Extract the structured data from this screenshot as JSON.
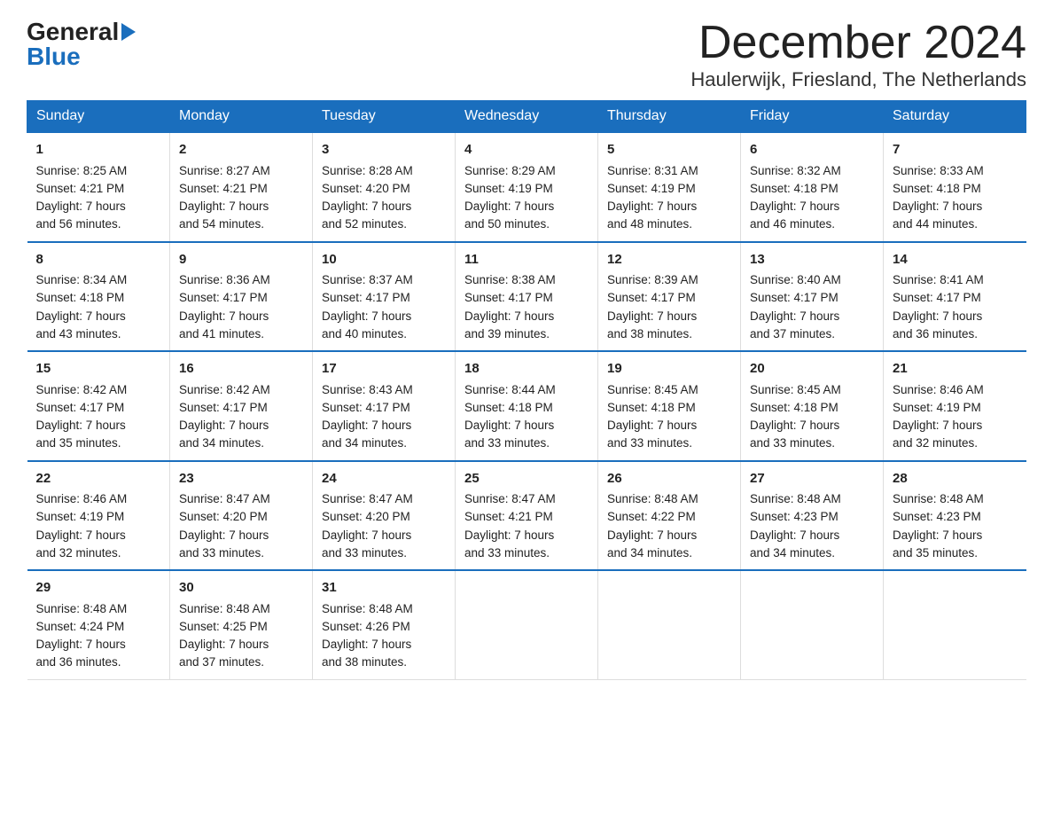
{
  "header": {
    "month_year": "December 2024",
    "location": "Haulerwijk, Friesland, The Netherlands"
  },
  "logo": {
    "part1": "General",
    "part2": "Blue"
  },
  "days_of_week": [
    "Sunday",
    "Monday",
    "Tuesday",
    "Wednesday",
    "Thursday",
    "Friday",
    "Saturday"
  ],
  "weeks": [
    [
      {
        "day": "1",
        "sunrise": "8:25 AM",
        "sunset": "4:21 PM",
        "daylight": "7 hours and 56 minutes."
      },
      {
        "day": "2",
        "sunrise": "8:27 AM",
        "sunset": "4:21 PM",
        "daylight": "7 hours and 54 minutes."
      },
      {
        "day": "3",
        "sunrise": "8:28 AM",
        "sunset": "4:20 PM",
        "daylight": "7 hours and 52 minutes."
      },
      {
        "day": "4",
        "sunrise": "8:29 AM",
        "sunset": "4:19 PM",
        "daylight": "7 hours and 50 minutes."
      },
      {
        "day": "5",
        "sunrise": "8:31 AM",
        "sunset": "4:19 PM",
        "daylight": "7 hours and 48 minutes."
      },
      {
        "day": "6",
        "sunrise": "8:32 AM",
        "sunset": "4:18 PM",
        "daylight": "7 hours and 46 minutes."
      },
      {
        "day": "7",
        "sunrise": "8:33 AM",
        "sunset": "4:18 PM",
        "daylight": "7 hours and 44 minutes."
      }
    ],
    [
      {
        "day": "8",
        "sunrise": "8:34 AM",
        "sunset": "4:18 PM",
        "daylight": "7 hours and 43 minutes."
      },
      {
        "day": "9",
        "sunrise": "8:36 AM",
        "sunset": "4:17 PM",
        "daylight": "7 hours and 41 minutes."
      },
      {
        "day": "10",
        "sunrise": "8:37 AM",
        "sunset": "4:17 PM",
        "daylight": "7 hours and 40 minutes."
      },
      {
        "day": "11",
        "sunrise": "8:38 AM",
        "sunset": "4:17 PM",
        "daylight": "7 hours and 39 minutes."
      },
      {
        "day": "12",
        "sunrise": "8:39 AM",
        "sunset": "4:17 PM",
        "daylight": "7 hours and 38 minutes."
      },
      {
        "day": "13",
        "sunrise": "8:40 AM",
        "sunset": "4:17 PM",
        "daylight": "7 hours and 37 minutes."
      },
      {
        "day": "14",
        "sunrise": "8:41 AM",
        "sunset": "4:17 PM",
        "daylight": "7 hours and 36 minutes."
      }
    ],
    [
      {
        "day": "15",
        "sunrise": "8:42 AM",
        "sunset": "4:17 PM",
        "daylight": "7 hours and 35 minutes."
      },
      {
        "day": "16",
        "sunrise": "8:42 AM",
        "sunset": "4:17 PM",
        "daylight": "7 hours and 34 minutes."
      },
      {
        "day": "17",
        "sunrise": "8:43 AM",
        "sunset": "4:17 PM",
        "daylight": "7 hours and 34 minutes."
      },
      {
        "day": "18",
        "sunrise": "8:44 AM",
        "sunset": "4:18 PM",
        "daylight": "7 hours and 33 minutes."
      },
      {
        "day": "19",
        "sunrise": "8:45 AM",
        "sunset": "4:18 PM",
        "daylight": "7 hours and 33 minutes."
      },
      {
        "day": "20",
        "sunrise": "8:45 AM",
        "sunset": "4:18 PM",
        "daylight": "7 hours and 33 minutes."
      },
      {
        "day": "21",
        "sunrise": "8:46 AM",
        "sunset": "4:19 PM",
        "daylight": "7 hours and 32 minutes."
      }
    ],
    [
      {
        "day": "22",
        "sunrise": "8:46 AM",
        "sunset": "4:19 PM",
        "daylight": "7 hours and 32 minutes."
      },
      {
        "day": "23",
        "sunrise": "8:47 AM",
        "sunset": "4:20 PM",
        "daylight": "7 hours and 33 minutes."
      },
      {
        "day": "24",
        "sunrise": "8:47 AM",
        "sunset": "4:20 PM",
        "daylight": "7 hours and 33 minutes."
      },
      {
        "day": "25",
        "sunrise": "8:47 AM",
        "sunset": "4:21 PM",
        "daylight": "7 hours and 33 minutes."
      },
      {
        "day": "26",
        "sunrise": "8:48 AM",
        "sunset": "4:22 PM",
        "daylight": "7 hours and 34 minutes."
      },
      {
        "day": "27",
        "sunrise": "8:48 AM",
        "sunset": "4:23 PM",
        "daylight": "7 hours and 34 minutes."
      },
      {
        "day": "28",
        "sunrise": "8:48 AM",
        "sunset": "4:23 PM",
        "daylight": "7 hours and 35 minutes."
      }
    ],
    [
      {
        "day": "29",
        "sunrise": "8:48 AM",
        "sunset": "4:24 PM",
        "daylight": "7 hours and 36 minutes."
      },
      {
        "day": "30",
        "sunrise": "8:48 AM",
        "sunset": "4:25 PM",
        "daylight": "7 hours and 37 minutes."
      },
      {
        "day": "31",
        "sunrise": "8:48 AM",
        "sunset": "4:26 PM",
        "daylight": "7 hours and 38 minutes."
      },
      null,
      null,
      null,
      null
    ]
  ],
  "labels": {
    "sunrise": "Sunrise:",
    "sunset": "Sunset:",
    "daylight": "Daylight:"
  }
}
